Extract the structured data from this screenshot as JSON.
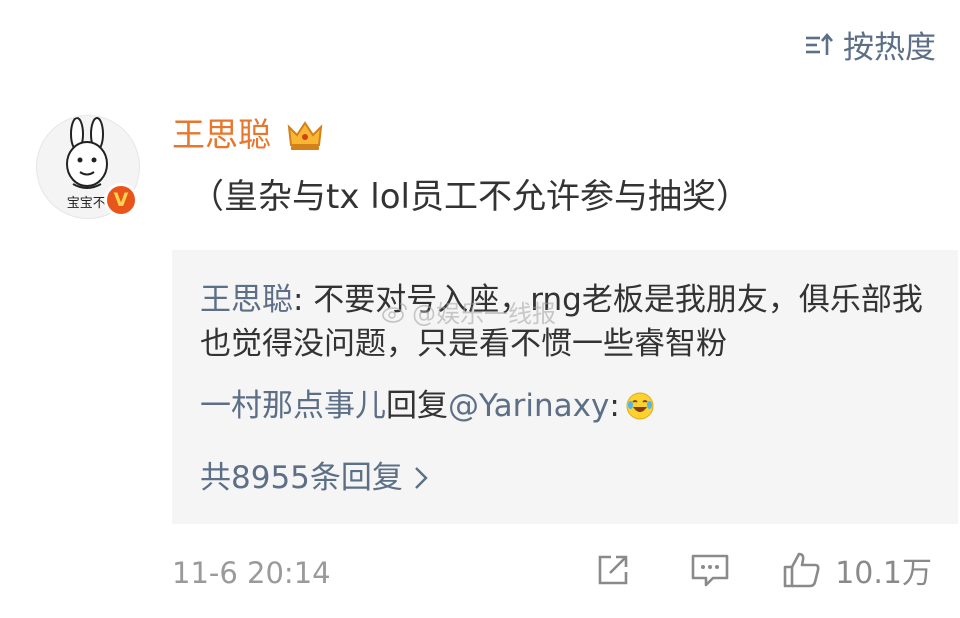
{
  "header": {
    "sort_label": "按热度",
    "sort_icon": "sort-icon"
  },
  "comment": {
    "avatar_text": "宝宝不l",
    "verified_badge": "V",
    "username": "王思聪",
    "username_color": "#e8762d",
    "text": "（皇杂与tx lol员工不允许参与抽奖）",
    "timestamp": "11-6 20:14",
    "like_count": "10.1万"
  },
  "replies": {
    "first": {
      "author": "王思聪",
      "separator": ":",
      "text": " 不要对号入座，rng老板是我朋友，俱乐部我也觉得没问题，只是看不惯一些睿智粉"
    },
    "second": {
      "author": "一村那点事儿",
      "verb": "回复",
      "mention": "@Yarinaxy",
      "separator": ":"
    },
    "total_label": "共8955条回复"
  },
  "watermark": "@娱乐一线报",
  "colors": {
    "link": "#5d6f86",
    "reply_bg": "#f5f5f5",
    "meta": "#9a9a9a"
  }
}
